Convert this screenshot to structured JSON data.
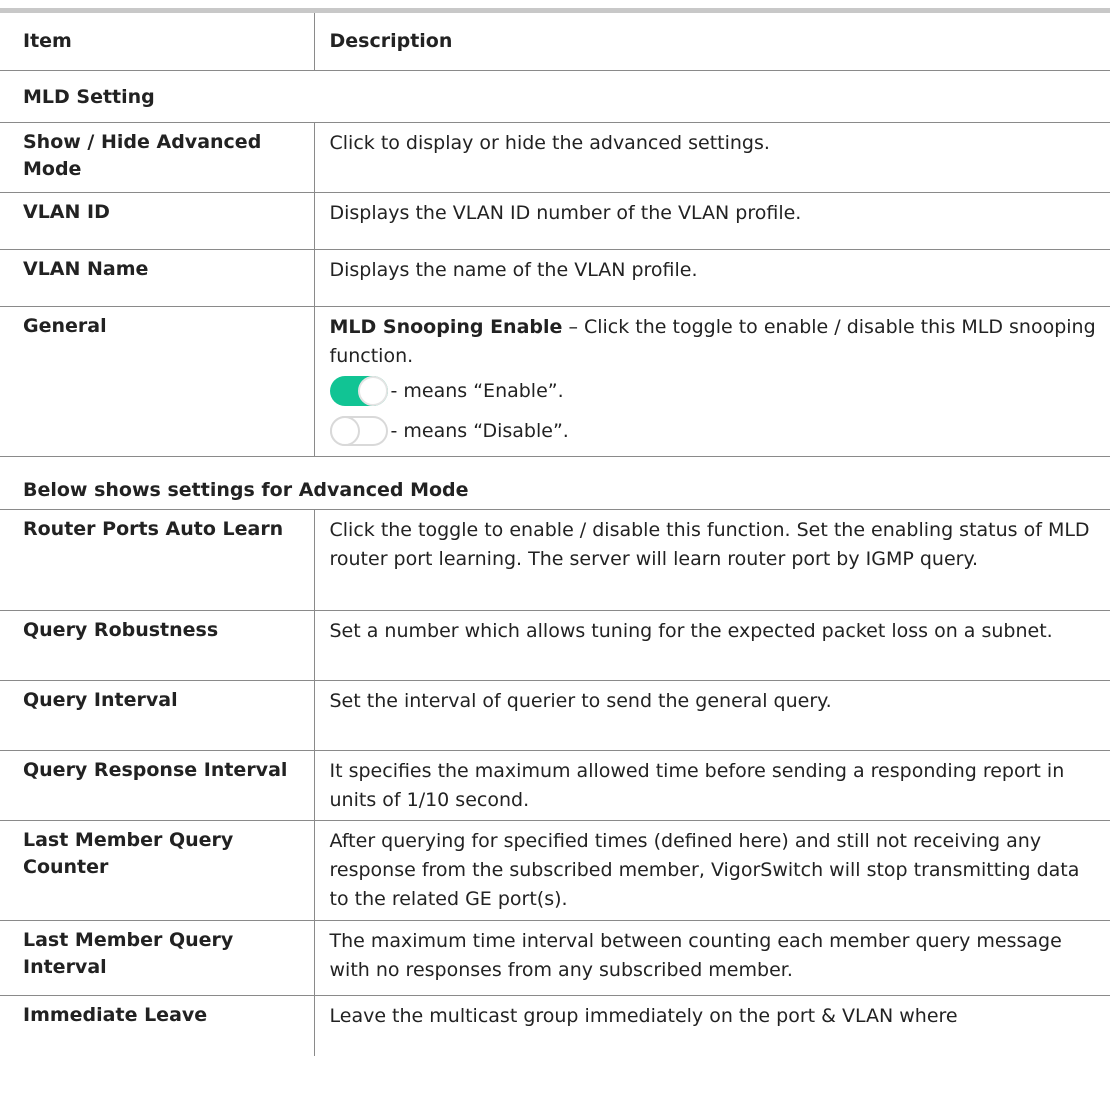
{
  "header": {
    "item": "Item",
    "description": "Description"
  },
  "sections": {
    "mld_setting": "MLD Setting",
    "advanced": "Below shows settings for Advanced Mode"
  },
  "rows1": [
    {
      "item": "Show / Hide Advanced Mode",
      "desc": "Click to display or hide the advanced settings."
    },
    {
      "item": "VLAN ID",
      "desc": "Displays the VLAN ID number of the VLAN profile."
    },
    {
      "item": "VLAN Name",
      "desc": "Displays the name of the VLAN profile."
    }
  ],
  "general": {
    "item": "General",
    "bold": "MLD Snooping Enable",
    "text": " – Click the toggle to enable / disable this MLD snooping function.",
    "enable_text": "- means “Enable”.",
    "disable_text": "- means “Disable”.",
    "enable_color": "#11c494"
  },
  "rows2": [
    {
      "item": "Router Ports Auto Learn",
      "desc": "Click the toggle to enable / disable this function. Set the enabling status of MLD router port learning. The server will learn router port by IGMP query."
    },
    {
      "item": "Query Robustness",
      "desc": "Set a number which allows tuning for the expected packet loss on a subnet."
    },
    {
      "item": "Query Interval",
      "desc": "Set the interval of querier to send the general query."
    },
    {
      "item": "Query Response Interval",
      "desc": "It specifies the maximum allowed time before sending a responding report in units of 1/10 second."
    },
    {
      "item": "Last Member Query Counter",
      "desc": "After querying for specified times (defined here) and still not receiving any response from the subscribed member, VigorSwitch will stop transmitting data to the related GE port(s)."
    },
    {
      "item": "Last Member Query Interval",
      "desc": "The maximum time interval between counting each member query message with no responses from any subscribed member."
    },
    {
      "item": "Immediate Leave",
      "desc": "Leave the multicast group immediately on the port & VLAN where"
    }
  ]
}
